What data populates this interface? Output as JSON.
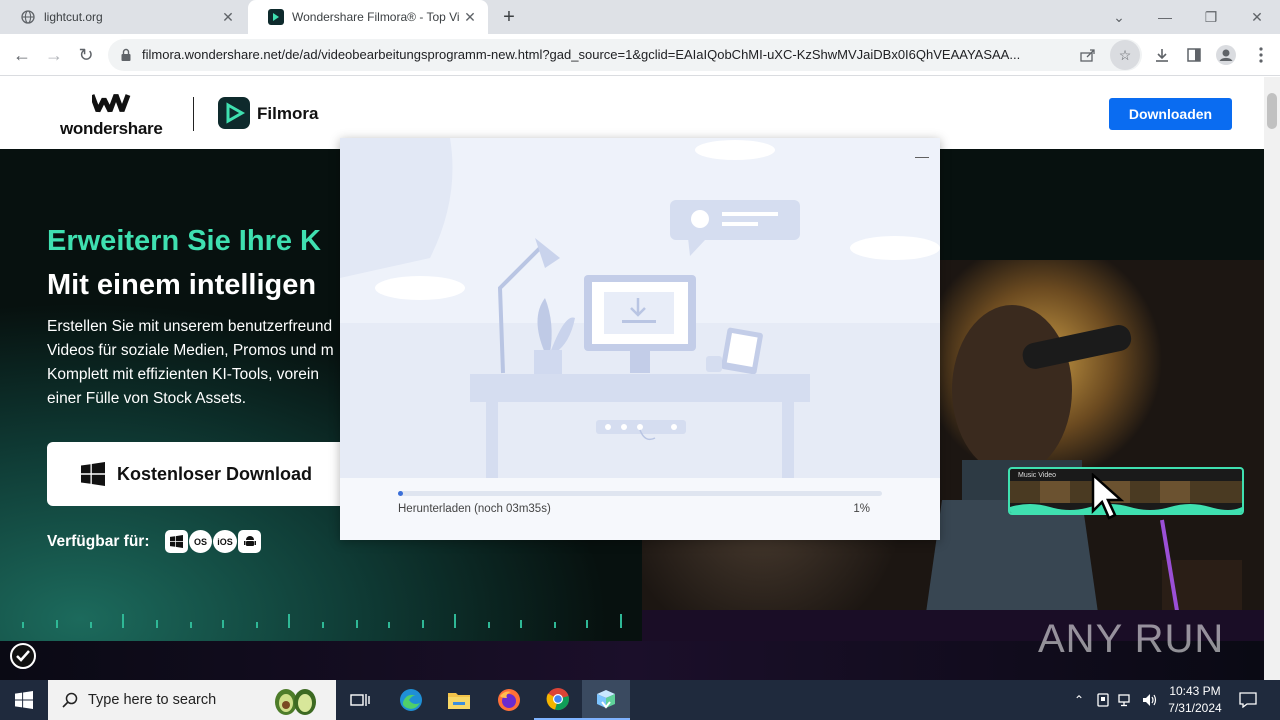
{
  "browser": {
    "tabs": [
      {
        "title": "lightcut.org",
        "icon": "globe-icon",
        "active": false
      },
      {
        "title": "Wondershare Filmora® - Top Vi",
        "icon": "filmora-favicon",
        "active": true
      }
    ],
    "url": "filmora.wondershare.net/de/ad/videobearbeitungsprogramm-new.html?gad_source=1&gclid=EAIaIQobChMI-uXC-KzShwMVJaiDBx0I6QhVEAAYASAA..."
  },
  "site": {
    "brand": "wondershare",
    "product": "Filmora",
    "header_download": "Downloaden",
    "accent": "#3fe0b0",
    "button_color": "#0a6cf1"
  },
  "hero": {
    "headline_1": "Erweitern Sie Ihre K",
    "headline_2": "Mit einem intelligen",
    "paragraph": [
      "Erstellen Sie mit unserem benutzerfreund",
      "Videos für soziale Medien, Promos und m",
      "Komplett mit effizienten KI-Tools, vorein",
      "einer Fülle von Stock Assets."
    ],
    "cta_label": "Kostenloser Download",
    "available_label": "Verfügbar für:",
    "platforms": [
      "windows-icon",
      "macos-icon",
      "ios-icon",
      "android-icon"
    ],
    "strip_label": "Music Video"
  },
  "installer": {
    "status": "Herunterladen (noch 03m35s)",
    "percent_label": "1%",
    "progress": 0.01
  },
  "watermark": "ANY RUN",
  "taskbar": {
    "search_placeholder": "Type here to search",
    "time": "10:43 PM",
    "date": "7/31/2024"
  }
}
